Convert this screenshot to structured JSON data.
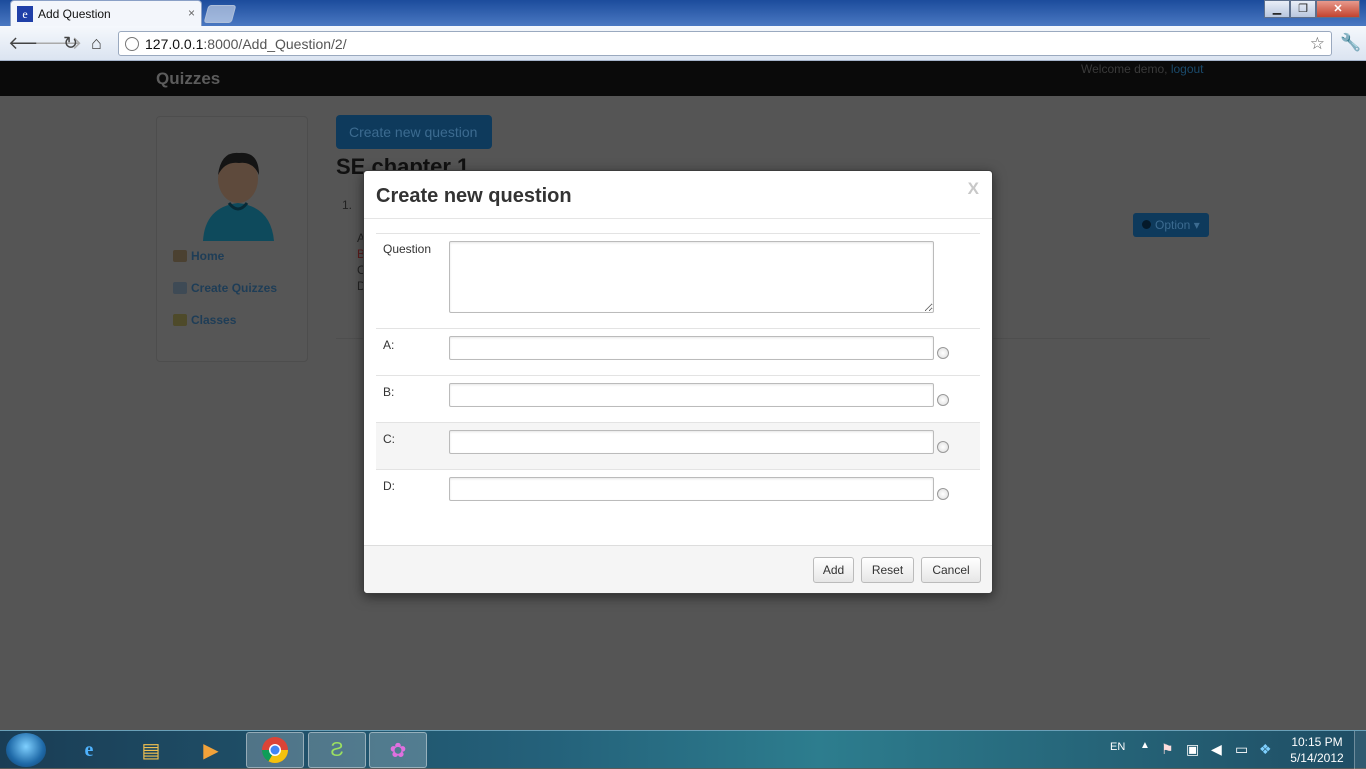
{
  "browser": {
    "tab_title": "Add Question",
    "tab_favicon": "e",
    "tab_close": "×",
    "url_host": "127.0.0.1",
    "url_rest": ":8000/Add_Question/2/",
    "window_buttons": {
      "minimize": "▁",
      "maximize": "❐",
      "close": "✕"
    },
    "nav_icons": {
      "back": "back-arrow-icon",
      "forward": "forward-arrow-icon",
      "reload": "reload-icon",
      "home": "home-icon",
      "star": "star-icon",
      "wrench": "wrench-icon"
    }
  },
  "page": {
    "brand": "Quizzes",
    "welcome_text": "Welcome demo, ",
    "logout_label": "logout",
    "sidebar": {
      "items": [
        {
          "label": "Home"
        },
        {
          "label": "Create Quizzes"
        },
        {
          "label": "Classes"
        }
      ]
    },
    "create_button_label": "Create new question",
    "quiz_title": "SE chapter 1",
    "question_number": "1.",
    "option_letters": [
      "A",
      "B",
      "C",
      "D"
    ],
    "option_button_label": "Option"
  },
  "modal": {
    "title": "Create new question",
    "close_label": "X",
    "question_label": "Question",
    "question_value": "",
    "answers": [
      {
        "label": "A:",
        "value": ""
      },
      {
        "label": "B:",
        "value": ""
      },
      {
        "label": "C:",
        "value": ""
      },
      {
        "label": "D:",
        "value": ""
      }
    ],
    "buttons": {
      "add": "Add",
      "reset": "Reset",
      "cancel": "Cancel"
    }
  },
  "taskbar": {
    "language": "EN",
    "time": "10:15 PM",
    "date": "5/14/2012",
    "apps": [
      "windows-start-icon",
      "internet-explorer-icon",
      "file-explorer-icon",
      "media-player-icon",
      "chrome-icon",
      "app-icon",
      "messenger-icon"
    ]
  }
}
